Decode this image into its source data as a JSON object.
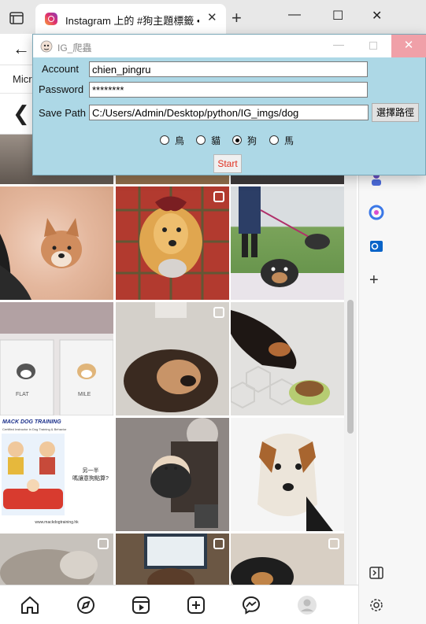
{
  "browser": {
    "tab_title": "Instagram 上的 #狗主題標籤 • 相片和影片",
    "favorites_first": "Micr",
    "controls": {
      "minimize": "—",
      "maximize": "☐",
      "close": "✕",
      "new_tab": "+",
      "tab_close": "✕"
    }
  },
  "dialog": {
    "title": "IG_爬蟲",
    "account_label": "Account",
    "account_value": "chien_pingru",
    "password_label": "Password",
    "password_value": "********",
    "savepath_label": "Save Path",
    "savepath_value": "C:/Users/Admin/Desktop/python/IG_imgs/dog",
    "browse_button": "選擇路徑",
    "radios": [
      {
        "label": "鳥",
        "selected": false
      },
      {
        "label": "貓",
        "selected": false
      },
      {
        "label": "狗",
        "selected": true
      },
      {
        "label": "馬",
        "selected": false
      }
    ],
    "start_button": "Start",
    "close_glyph": "✕",
    "min_glyph": "—"
  },
  "grid": {
    "ad_card": {
      "brand": "MACK DOG TRAINING",
      "line1": "Certified Instructor in Dog Training & Behavior",
      "bubble": "另一半\n嗎讓意狗點算?",
      "footer": "www.mackdogtraining.hk"
    },
    "frame_left_text": "FLAT",
    "frame_right_text": "MILE"
  },
  "nav": {
    "icons": [
      "home-icon",
      "explore-icon",
      "reels-icon",
      "create-icon",
      "messenger-icon",
      "profile-icon"
    ]
  },
  "colors": {
    "dialog_bg": "#add8e6",
    "start_text": "#e03020",
    "close_bg": "#f0a0a8"
  }
}
